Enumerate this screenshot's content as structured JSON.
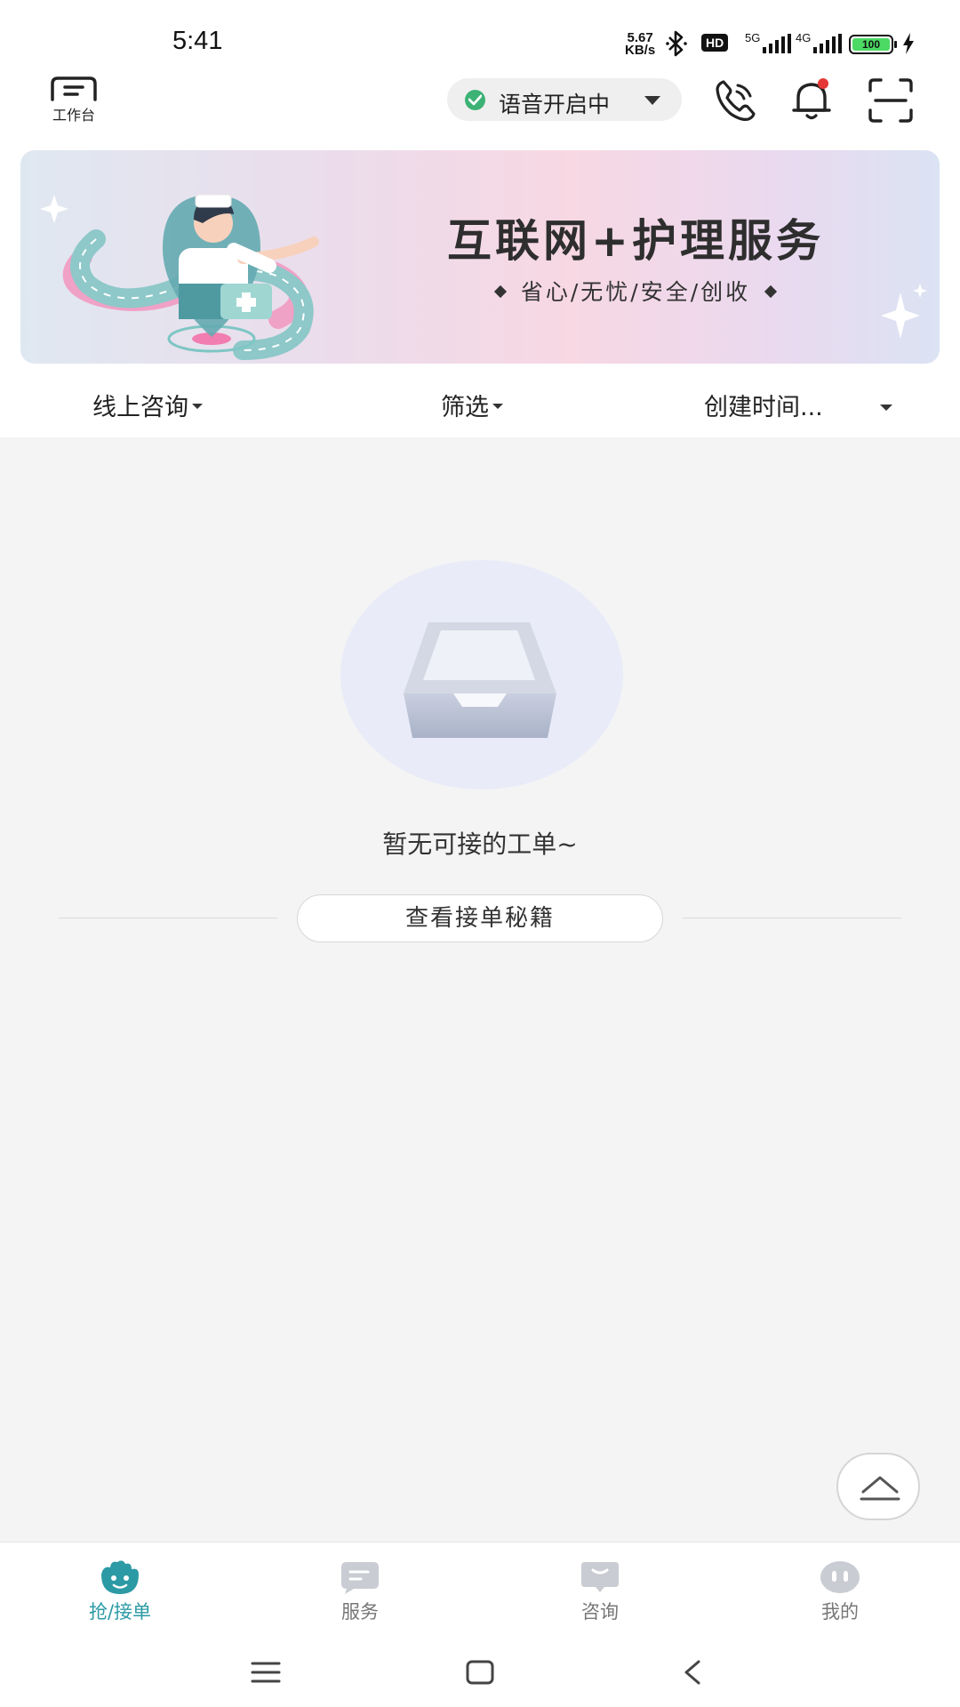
{
  "status_bar": {
    "time": "5:41",
    "net_speed_value": "5.67",
    "net_speed_unit": "KB/s",
    "hd_label": "HD",
    "sim1_label": "5G",
    "sim2_label": "4G",
    "battery": "100"
  },
  "header": {
    "workbench_label": "工作台",
    "voice_status": "语音开启中",
    "icons": [
      "phone-icon",
      "bell-icon",
      "scan-icon"
    ],
    "bell_has_badge": true
  },
  "banner": {
    "title": "互联网+护理服务",
    "subtitle": "省心/无忧/安全/创收"
  },
  "filters": {
    "consult": "线上咨询",
    "filter": "筛选",
    "created_time": "创建时间..."
  },
  "empty": {
    "message": "暂无可接的工单~",
    "tips_button": "查看接单秘籍"
  },
  "tabbar": {
    "items": [
      {
        "label": "抢/接单",
        "icon": "grab-order-icon",
        "active": true
      },
      {
        "label": "服务",
        "icon": "service-icon",
        "active": false
      },
      {
        "label": "咨询",
        "icon": "consult-icon",
        "active": false
      },
      {
        "label": "我的",
        "icon": "profile-icon",
        "active": false
      }
    ]
  },
  "colors": {
    "accent": "#2b9aa5",
    "voice_on": "#3db275",
    "badge": "#e53935",
    "background": "#f4f4f5"
  }
}
